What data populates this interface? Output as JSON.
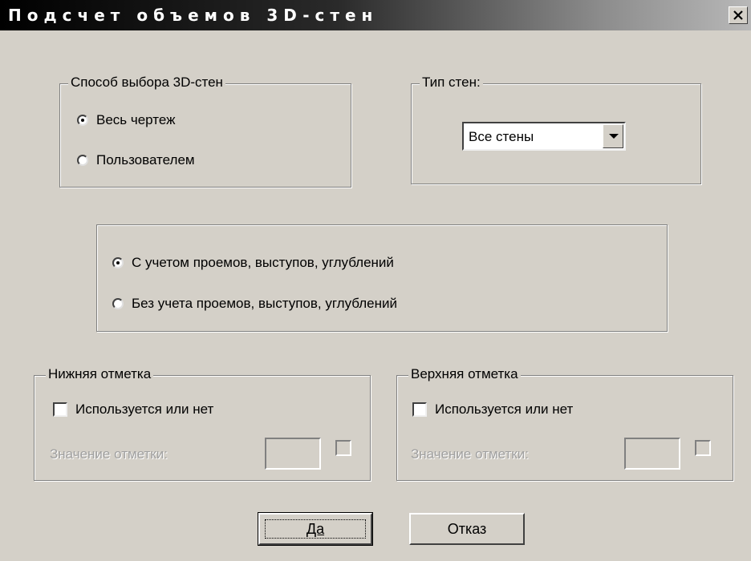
{
  "window": {
    "title": "Подсчет объемов 3D-стен",
    "close_label": "×"
  },
  "selection_group": {
    "legend": "Способ выбора 3D-стен",
    "options": [
      {
        "label": "Весь чертеж",
        "checked": true
      },
      {
        "label": "Пользователем",
        "checked": false
      }
    ]
  },
  "wall_type_group": {
    "legend": "Тип стен:",
    "selected": "Все стены"
  },
  "openings_group": {
    "options": [
      {
        "label": "С учетом проемов, выступов, углублений",
        "checked": true
      },
      {
        "label": "Без учета проемов, выступов, углублений",
        "checked": false
      }
    ]
  },
  "lower_mark": {
    "legend": "Нижняя отметка",
    "checkbox_label": "Используется или нет",
    "value_label": "Значение отметки:"
  },
  "upper_mark": {
    "legend": "Верхняя отметка",
    "checkbox_label": "Используется или нет",
    "value_label": "Значение отметки:"
  },
  "buttons": {
    "ok": "Да",
    "cancel": "Отказ"
  }
}
